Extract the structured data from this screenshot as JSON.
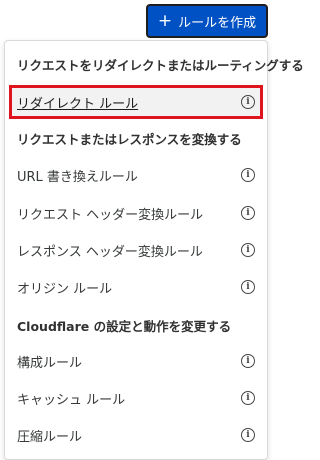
{
  "header": {
    "create_button_label": "ルールを作成",
    "create_button_icon": "plus-icon"
  },
  "menu": {
    "sections": [
      {
        "title": "リクエストをリダイレクトまたはルーティングする",
        "items": [
          {
            "label": "リダイレクト ルール",
            "icon": "info-icon",
            "highlighted": true
          }
        ]
      },
      {
        "title": "リクエストまたはレスポンスを変換する",
        "items": [
          {
            "label": "URL 書き換えルール",
            "icon": "info-icon"
          },
          {
            "label": "リクエスト ヘッダー変換ルール",
            "icon": "info-icon"
          },
          {
            "label": "レスポンス ヘッダー変換ルール",
            "icon": "info-icon"
          },
          {
            "label": "オリジン ルール",
            "icon": "info-icon"
          }
        ]
      },
      {
        "title": "Cloudflare の設定と動作を変更する",
        "items": [
          {
            "label": "構成ルール",
            "icon": "info-icon"
          },
          {
            "label": "キャッシュ ルール",
            "icon": "info-icon"
          },
          {
            "label": "圧縮ルール",
            "icon": "info-icon"
          }
        ]
      }
    ]
  },
  "colors": {
    "button_bg": "#0051c3",
    "highlight_border": "#e0141e"
  }
}
